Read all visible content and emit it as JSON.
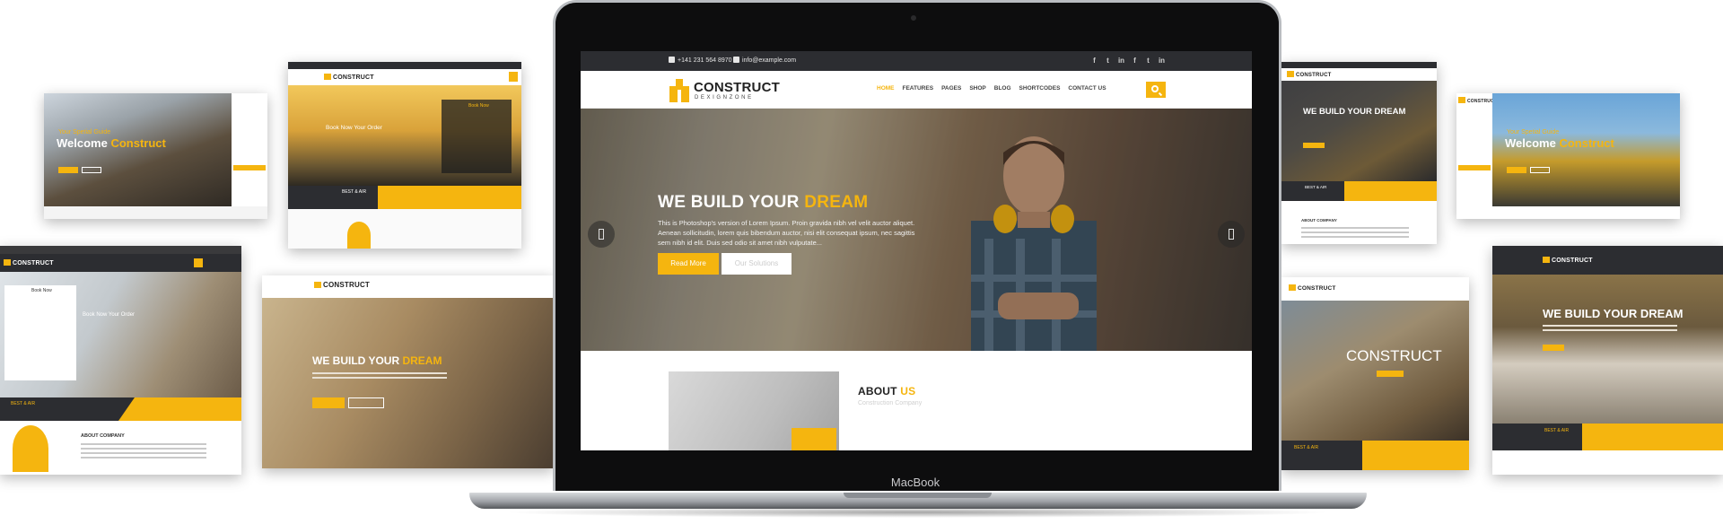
{
  "main_site": {
    "topbar": {
      "phone": "+141 231 564 8970",
      "email": "info@example.com",
      "social_icons": [
        "facebook-icon",
        "twitter-icon",
        "linkedin-icon",
        "facebook-icon",
        "twitter-icon",
        "linkedin-icon"
      ]
    },
    "logo": {
      "name": "CONSTRUCT",
      "sub": "DEXIGNZONE"
    },
    "nav": [
      "HOME",
      "FEATURES",
      "PAGES",
      "SHOP",
      "BLOG",
      "SHORTCODES",
      "CONTACT US"
    ],
    "active_nav": "HOME",
    "hero": {
      "title_white": "WE BUILD YOUR",
      "title_yellow": "DREAM",
      "text": "This is Photoshop's version of Lorem Ipsum. Proin gravida nibh vel velit auctor aliquet. Aenean sollicitudin, lorem quis bibendum auctor, nisi elit consequat ipsum, nec sagittis sem nibh id elit. Duis sed odio sit amet nibh vulputate...",
      "btn_primary": "Read More",
      "btn_secondary": "Our Solutions"
    },
    "about": {
      "title_dark": "ABOUT",
      "title_yellow": "US",
      "subtitle": "Construction Company"
    }
  },
  "device_label": "MacBook",
  "side_screens": {
    "s1": {
      "subtitle": "Your Spetial Guide",
      "title_white": "Welcome",
      "title_yellow": "Construct"
    },
    "s2": {
      "title": "Book Now Your Order",
      "form_title": "Book Now",
      "cta": "BEST & AIR"
    },
    "s3": {
      "form_title": "Book Now",
      "title": "Book Now Your Order",
      "cta": "BEST & AIR",
      "about": "ABOUT COMPANY"
    },
    "s4": {
      "logo": "CONSTRUCT",
      "logo_sub": "DEXIGNZONE",
      "title_white": "WE BUILD YOUR",
      "title_yellow": "DREAM",
      "text": "This is Photoshop's version of Lorem Ipsum. Proin gravida nibh vel velit auctor aliquet. Aenean sollicitudin, lorem quis bibendum auctor, nisi elit consequat ipsum, nec sagittis sem nibh id elit.",
      "btn_primary": "Read More",
      "btn_secondary": "Our Solutions"
    },
    "s5": {
      "title": "WE BUILD YOUR DREAM",
      "cta": "BEST & AIR",
      "about": "ABOUT COMPANY"
    },
    "s6": {
      "subtitle": "Your Spetial Guide",
      "title_white": "Welcome",
      "title_yellow": "Construct"
    },
    "s7": {
      "logo": "CONSTRUCT",
      "title": "CONSTRUCT",
      "cta": "BEST & AIR"
    },
    "s8": {
      "logo": "CONSTRUCT",
      "title": "WE BUILD YOUR DREAM",
      "cta": "BEST & AIR"
    }
  },
  "colors": {
    "accent": "#f5b50f",
    "topbar": "#2c2d31"
  }
}
